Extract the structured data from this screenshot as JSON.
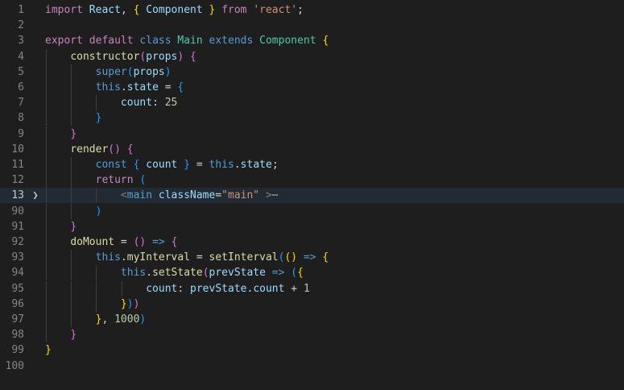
{
  "editor": {
    "language": "javascript",
    "lines": [
      {
        "n": "1",
        "tokens": [
          [
            "kw",
            "import"
          ],
          [
            "pl",
            " "
          ],
          [
            "var",
            "React"
          ],
          [
            "pl",
            ", "
          ],
          [
            "p1",
            "{"
          ],
          [
            "pl",
            " "
          ],
          [
            "var",
            "Component"
          ],
          [
            "pl",
            " "
          ],
          [
            "p1",
            "}"
          ],
          [
            "pl",
            " "
          ],
          [
            "kw",
            "from"
          ],
          [
            "pl",
            " "
          ],
          [
            "str",
            "'react'"
          ],
          [
            "pl",
            ";"
          ]
        ]
      },
      {
        "n": "2",
        "tokens": []
      },
      {
        "n": "3",
        "tokens": [
          [
            "kw",
            "export"
          ],
          [
            "pl",
            " "
          ],
          [
            "kw",
            "default"
          ],
          [
            "pl",
            " "
          ],
          [
            "kw2",
            "class"
          ],
          [
            "pl",
            " "
          ],
          [
            "cls",
            "Main"
          ],
          [
            "pl",
            " "
          ],
          [
            "kw2",
            "extends"
          ],
          [
            "pl",
            " "
          ],
          [
            "cls",
            "Component"
          ],
          [
            "pl",
            " "
          ],
          [
            "p1",
            "{"
          ]
        ]
      },
      {
        "n": "4",
        "tokens": [
          [
            "pl",
            "    "
          ],
          [
            "fn",
            "constructor"
          ],
          [
            "p2",
            "("
          ],
          [
            "var",
            "props"
          ],
          [
            "p2",
            ")"
          ],
          [
            "pl",
            " "
          ],
          [
            "p2",
            "{"
          ]
        ]
      },
      {
        "n": "5",
        "tokens": [
          [
            "pl",
            "        "
          ],
          [
            "kw2",
            "super"
          ],
          [
            "p3",
            "("
          ],
          [
            "var",
            "props"
          ],
          [
            "p3",
            ")"
          ]
        ]
      },
      {
        "n": "6",
        "tokens": [
          [
            "pl",
            "        "
          ],
          [
            "kw2",
            "this"
          ],
          [
            "pl",
            "."
          ],
          [
            "var",
            "state"
          ],
          [
            "pl",
            " = "
          ],
          [
            "p3",
            "{"
          ]
        ]
      },
      {
        "n": "7",
        "tokens": [
          [
            "pl",
            "            "
          ],
          [
            "var",
            "count"
          ],
          [
            "pl",
            ": "
          ],
          [
            "num",
            "25"
          ]
        ]
      },
      {
        "n": "8",
        "tokens": [
          [
            "pl",
            "        "
          ],
          [
            "p3",
            "}"
          ]
        ]
      },
      {
        "n": "9",
        "tokens": [
          [
            "pl",
            "    "
          ],
          [
            "p2",
            "}"
          ]
        ]
      },
      {
        "n": "10",
        "tokens": [
          [
            "pl",
            "    "
          ],
          [
            "fn",
            "render"
          ],
          [
            "p2",
            "()"
          ],
          [
            "pl",
            " "
          ],
          [
            "p2",
            "{"
          ]
        ]
      },
      {
        "n": "11",
        "tokens": [
          [
            "pl",
            "        "
          ],
          [
            "kw2",
            "const"
          ],
          [
            "pl",
            " "
          ],
          [
            "p3",
            "{"
          ],
          [
            "pl",
            " "
          ],
          [
            "var",
            "count"
          ],
          [
            "pl",
            " "
          ],
          [
            "p3",
            "}"
          ],
          [
            "pl",
            " = "
          ],
          [
            "kw2",
            "this"
          ],
          [
            "pl",
            "."
          ],
          [
            "var",
            "state"
          ],
          [
            "pl",
            ";"
          ]
        ]
      },
      {
        "n": "12",
        "tokens": [
          [
            "pl",
            "        "
          ],
          [
            "kw",
            "return"
          ],
          [
            "pl",
            " "
          ],
          [
            "p3",
            "("
          ]
        ]
      },
      {
        "n": "13",
        "tokens": [
          [
            "pl",
            "            "
          ],
          [
            "tagp",
            "<"
          ],
          [
            "tag",
            "main"
          ],
          [
            "pl",
            " "
          ],
          [
            "attr",
            "className"
          ],
          [
            "pl",
            "="
          ],
          [
            "str",
            "\"main\""
          ],
          [
            "pl",
            " "
          ],
          [
            "tagp",
            ">"
          ]
        ],
        "folded": true,
        "fold_ellipsis": "⋯"
      },
      {
        "n": "90",
        "tokens": [
          [
            "pl",
            "        "
          ],
          [
            "p3",
            ")"
          ]
        ]
      },
      {
        "n": "91",
        "tokens": [
          [
            "pl",
            "    "
          ],
          [
            "p2",
            "}"
          ]
        ]
      },
      {
        "n": "92",
        "tokens": [
          [
            "pl",
            "    "
          ],
          [
            "fn",
            "doMount"
          ],
          [
            "pl",
            " = "
          ],
          [
            "p2",
            "()"
          ],
          [
            "pl",
            " "
          ],
          [
            "kw2f",
            "=>"
          ],
          [
            "pl",
            " "
          ],
          [
            "p2",
            "{"
          ]
        ]
      },
      {
        "n": "93",
        "tokens": [
          [
            "pl",
            "        "
          ],
          [
            "kw2",
            "this"
          ],
          [
            "pl",
            "."
          ],
          [
            "fn",
            "myInterval"
          ],
          [
            "pl",
            " = "
          ],
          [
            "fn",
            "setInterval"
          ],
          [
            "p3",
            "("
          ],
          [
            "p1",
            "()"
          ],
          [
            "pl",
            " "
          ],
          [
            "kw2f",
            "=>"
          ],
          [
            "pl",
            " "
          ],
          [
            "p1",
            "{"
          ]
        ]
      },
      {
        "n": "94",
        "tokens": [
          [
            "pl",
            "            "
          ],
          [
            "kw2",
            "this"
          ],
          [
            "pl",
            "."
          ],
          [
            "fn",
            "setState"
          ],
          [
            "p2",
            "("
          ],
          [
            "var",
            "prevState"
          ],
          [
            "pl",
            " "
          ],
          [
            "kw2f",
            "=>"
          ],
          [
            "pl",
            " "
          ],
          [
            "p3",
            "("
          ],
          [
            "p1",
            "{"
          ]
        ]
      },
      {
        "n": "95",
        "tokens": [
          [
            "pl",
            "                "
          ],
          [
            "var",
            "count"
          ],
          [
            "pl",
            ": "
          ],
          [
            "var",
            "prevState"
          ],
          [
            "pl",
            "."
          ],
          [
            "var",
            "count"
          ],
          [
            "pl",
            " + "
          ],
          [
            "num",
            "1"
          ]
        ]
      },
      {
        "n": "96",
        "tokens": [
          [
            "pl",
            "            "
          ],
          [
            "p1",
            "}"
          ],
          [
            "p3",
            ")"
          ],
          [
            "p2",
            ")"
          ]
        ]
      },
      {
        "n": "97",
        "tokens": [
          [
            "pl",
            "        "
          ],
          [
            "p1",
            "}"
          ],
          [
            "pl",
            ", "
          ],
          [
            "num",
            "1000"
          ],
          [
            "p3",
            ")"
          ]
        ]
      },
      {
        "n": "98",
        "tokens": [
          [
            "pl",
            "    "
          ],
          [
            "p2",
            "}"
          ]
        ]
      },
      {
        "n": "99",
        "tokens": [
          [
            "p1",
            "}"
          ]
        ]
      },
      {
        "n": "100",
        "tokens": []
      }
    ],
    "current_line": "13",
    "fold_marker_glyph": "❯"
  }
}
